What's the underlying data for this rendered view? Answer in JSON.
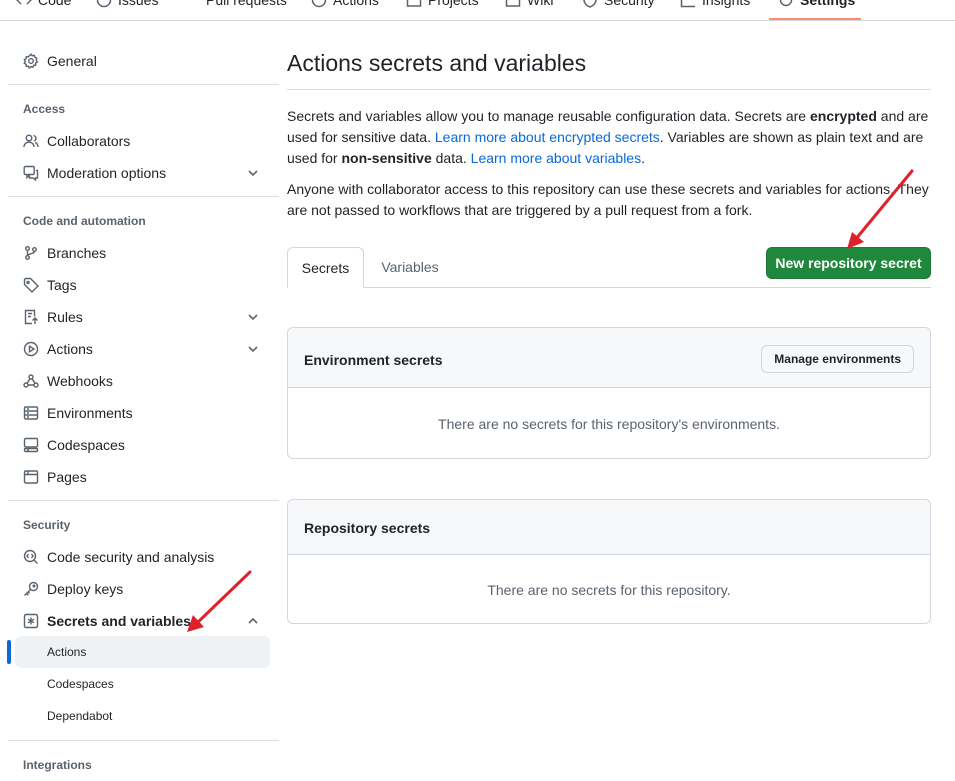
{
  "top_nav": {
    "tabs": [
      {
        "label": "Code",
        "icon": "code-icon"
      },
      {
        "label": "Issues",
        "icon": "issue-icon"
      },
      {
        "label": "Pull requests",
        "icon": "pull-request-icon"
      },
      {
        "label": "Actions",
        "icon": "play-icon"
      },
      {
        "label": "Projects",
        "icon": "table-icon"
      },
      {
        "label": "Wiki",
        "icon": "book-icon"
      },
      {
        "label": "Security",
        "icon": "shield-icon"
      },
      {
        "label": "Insights",
        "icon": "graph-icon"
      },
      {
        "label": "Settings",
        "icon": "gear-icon"
      }
    ],
    "selected": "Settings",
    "underline_color": "#fd8c73"
  },
  "sidebar": {
    "general": "General",
    "access_heading": "Access",
    "collaborators": "Collaborators",
    "moderation": "Moderation options",
    "code_heading": "Code and automation",
    "branches": "Branches",
    "tags": "Tags",
    "rules": "Rules",
    "actions": "Actions",
    "webhooks": "Webhooks",
    "environments": "Environments",
    "codespaces": "Codespaces",
    "pages": "Pages",
    "security_heading": "Security",
    "code_security": "Code security and analysis",
    "deploy_keys": "Deploy keys",
    "secrets_vars": "Secrets and variables",
    "sub_actions": "Actions",
    "sub_codespaces": "Codespaces",
    "sub_dependabot": "Dependabot",
    "integrations_heading": "Integrations"
  },
  "main": {
    "title": "Actions secrets and variables",
    "desc1_a": "Secrets and variables allow you to manage reusable configuration data. Secrets are ",
    "desc1_b": "encrypted",
    "desc1_c": " and are used for sensitive data. ",
    "desc1_link1": "Learn more about encrypted secrets",
    "desc1_d": ". Variables are shown as plain text and are used for ",
    "desc1_e": "non-sensitive",
    "desc1_f": " data. ",
    "desc1_link2": "Learn more about variables",
    "desc1_g": ".",
    "desc2": "Anyone with collaborator access to this repository can use these secrets and variables for actions. They are not passed to workflows that are triggered by a pull request from a fork.",
    "tab_secrets": "Secrets",
    "tab_variables": "Variables",
    "new_secret_button": "New repository secret",
    "env_title": "Environment secrets",
    "manage_env_button": "Manage environments",
    "env_empty": "There are no secrets for this repository's environments.",
    "repo_title": "Repository secrets",
    "repo_empty": "There are no secrets for this repository."
  },
  "colors": {
    "primary_button": "#1f883d",
    "link": "#0969da",
    "annotation_arrow": "#e0202a",
    "active_indicator": "#0969da"
  }
}
